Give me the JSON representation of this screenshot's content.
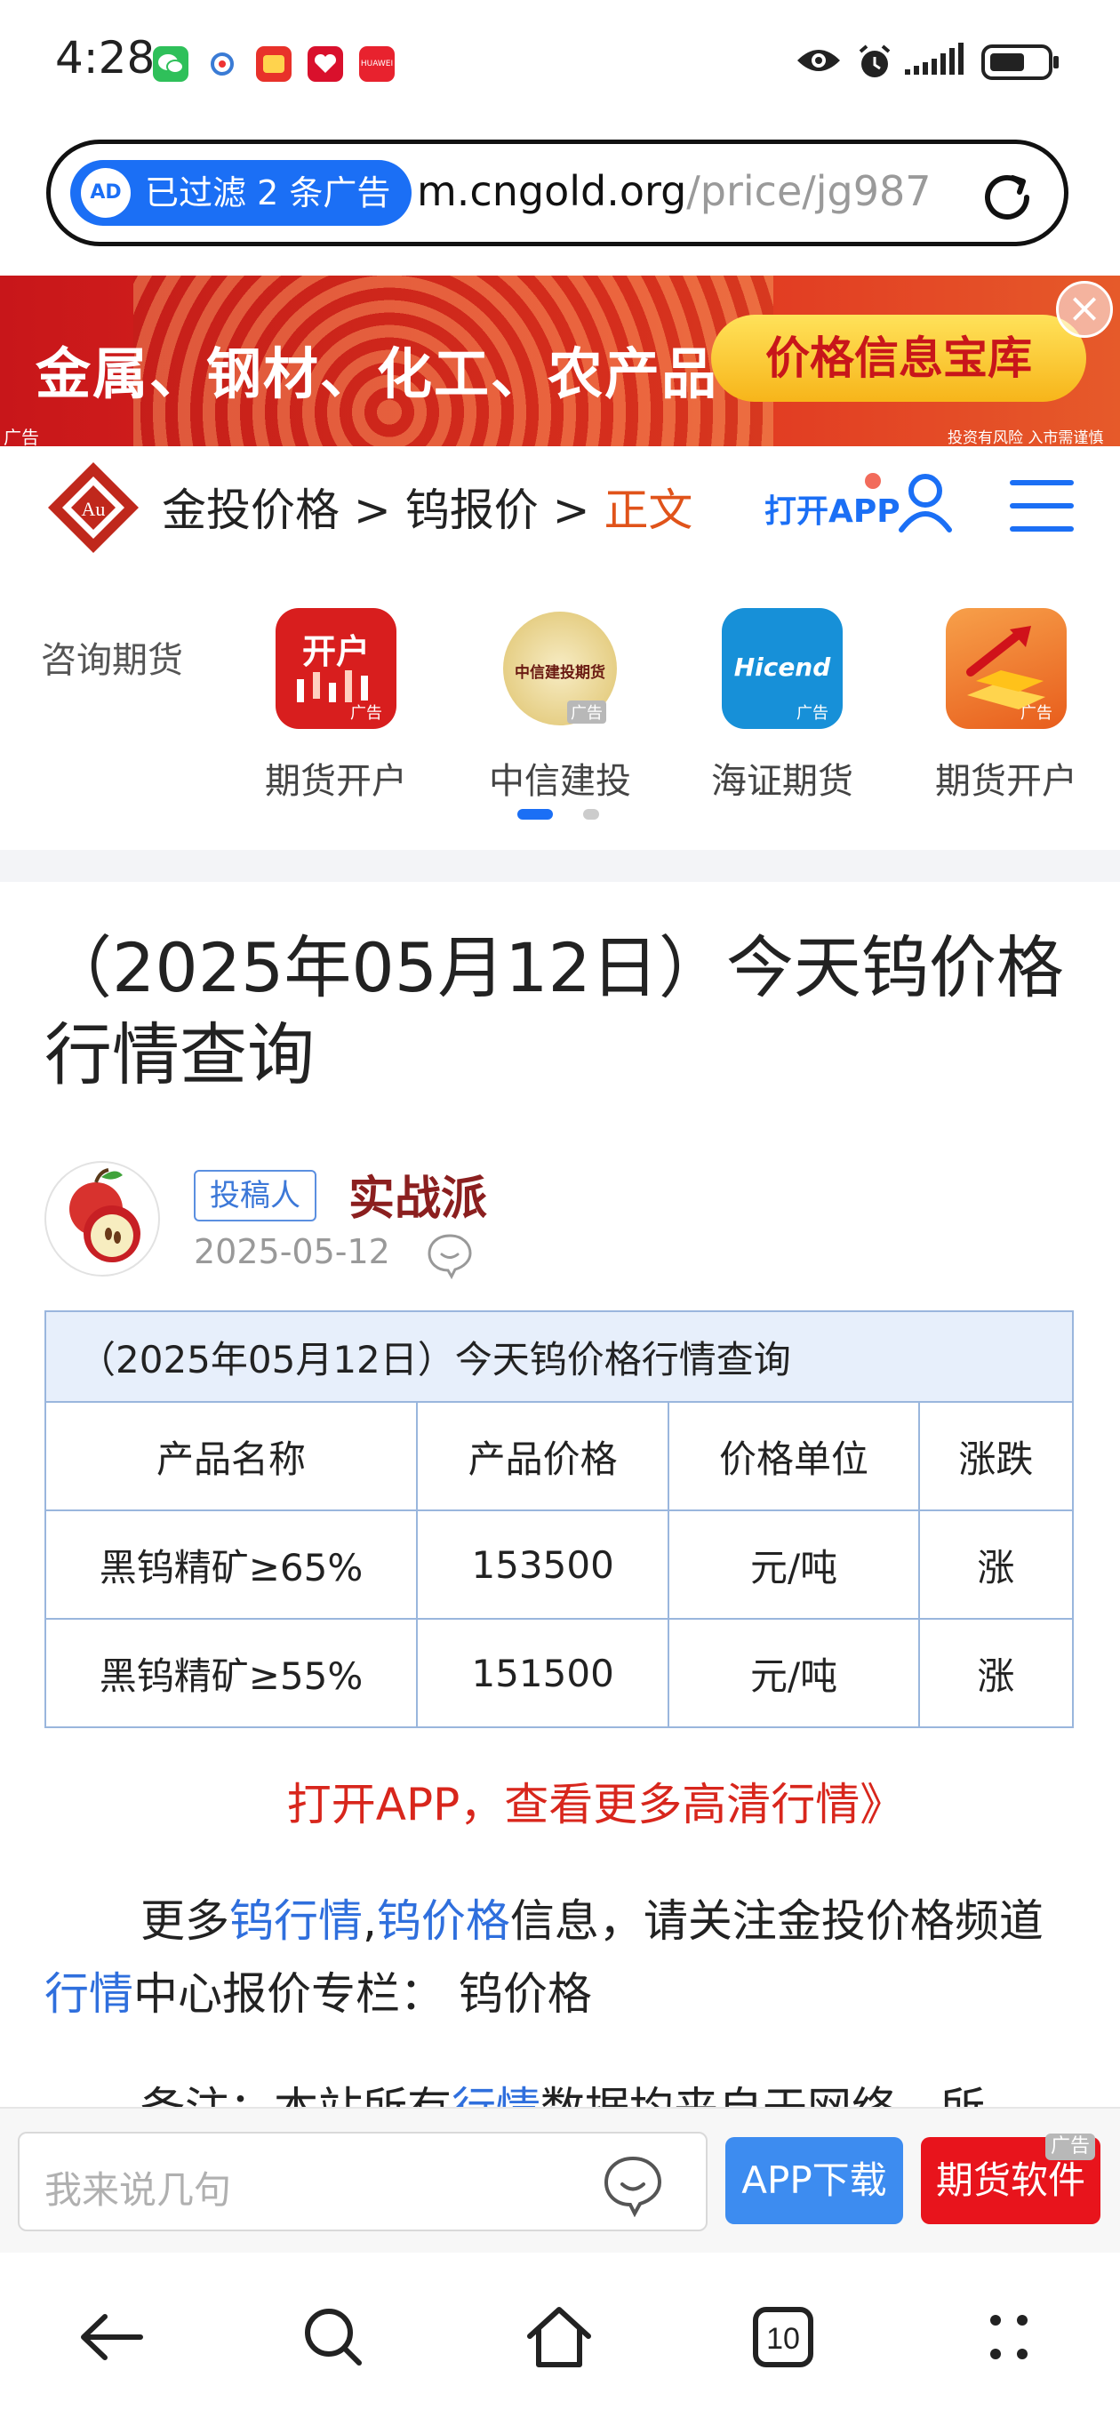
{
  "status_bar": {
    "time": "4:28",
    "notification_icons": [
      "wechat-icon",
      "weibo-icon",
      "meituan-icon",
      "pinduoduo-icon",
      "huawei-icon"
    ],
    "huawei_label": "HUAWEI",
    "right_icons": [
      "eye-icon",
      "alarm-icon",
      "signal-icon",
      "battery-icon"
    ]
  },
  "url_bar": {
    "ad_filter_text": "已过滤 2 条广告",
    "ad_badge": "AD",
    "url_host": "m.cngold.org",
    "url_path": "/price/jg987"
  },
  "banner": {
    "text": "金属、钢材、化工、农产品",
    "button": "价格信息宝库",
    "ad_tag": "广告",
    "risk_note": "投资有风险 入市需谨慎"
  },
  "site_header": {
    "logo_text": "Au",
    "breadcrumb": [
      "金投价格",
      ">",
      "钨报价",
      ">",
      "正文"
    ],
    "open_app": "打开APP"
  },
  "futures_strip": {
    "label": "咨询期货",
    "items": [
      {
        "name": "期货开户",
        "icon_text": "开户",
        "ad": "广告",
        "color": "#d81e1e"
      },
      {
        "name": "中信建投",
        "icon_text": "中信建投期货",
        "ad": "广告",
        "color": "#f2e6b8"
      },
      {
        "name": "海证期货",
        "icon_text": "Hicend",
        "ad": "广告",
        "color": "#1790d8"
      },
      {
        "name": "期货开户",
        "icon_text": "",
        "ad": "广告",
        "color": "#f07a22"
      }
    ]
  },
  "article": {
    "title": "（2025年05月12日）今天钨价格行情查询",
    "author_role": "投稿人",
    "author": "实战派",
    "date": "2025-05-12"
  },
  "table": {
    "caption": "（2025年05月12日）今天钨价格行情查询",
    "headers": [
      "产品名称",
      "产品价格",
      "价格单位",
      "涨跌"
    ],
    "rows": [
      [
        "黑钨精矿≥65%",
        "153500",
        "元/吨",
        "涨"
      ],
      [
        "黑钨精矿≥55%",
        "151500",
        "元/吨",
        "涨"
      ]
    ]
  },
  "cta": "打开APP，查看更多高清行情》",
  "para": {
    "p1": "更多",
    "l1": "钨行情",
    "p2": ",",
    "l2": "钨价格",
    "p3": "信息，请关注金投价格频道",
    "l3": "行情",
    "p4": "中心报价专栏： 钨价格"
  },
  "para2": {
    "p1": "备注：本站所有",
    "l1": "行情",
    "p2": "数据均来自于网络，所"
  },
  "comment_bar": {
    "placeholder": "我来说几句",
    "app_download": "APP下载",
    "futures_software": "期货软件",
    "ad_tag": "广告"
  },
  "nav": {
    "tab_count": "10"
  }
}
